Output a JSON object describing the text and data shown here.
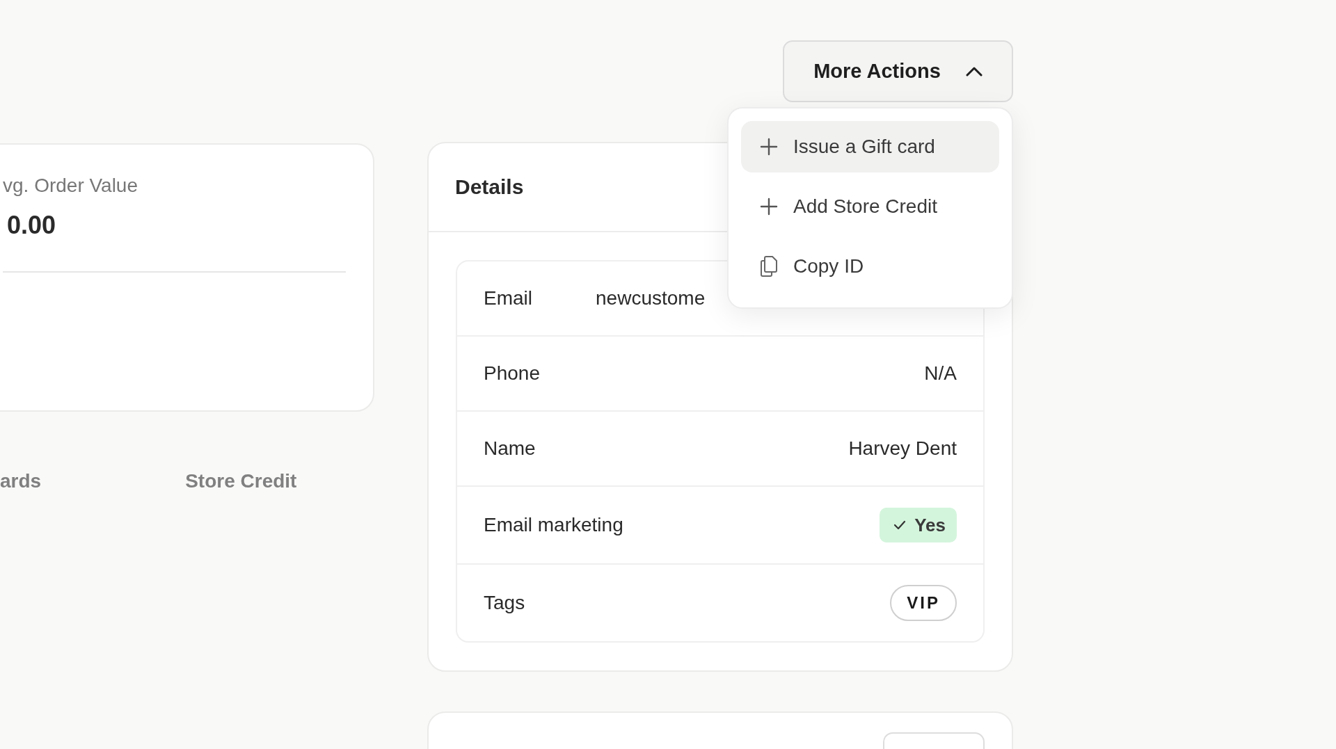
{
  "stats_card": {
    "label": "vg. Order Value",
    "value": "0.00"
  },
  "tabs": [
    {
      "label": "ards",
      "selected": false
    },
    {
      "label": "Store Credit",
      "selected": false
    }
  ],
  "more_actions": {
    "label": "More Actions",
    "expanded": true,
    "items": [
      {
        "kind": "add",
        "label": "Issue a Gift card",
        "highlighted": true
      },
      {
        "kind": "add",
        "label": "Add Store Credit",
        "highlighted": false
      },
      {
        "kind": "copy",
        "label": "Copy ID",
        "highlighted": false
      }
    ]
  },
  "details": {
    "title": "Details",
    "rows": [
      {
        "kind": "email",
        "label": "Email",
        "value": "newcustome"
      },
      {
        "kind": "text",
        "label": "Phone",
        "value": "N/A"
      },
      {
        "kind": "text",
        "label": "Name",
        "value": "Harvey Dent"
      },
      {
        "kind": "status",
        "label": "Email marketing",
        "value": "Yes",
        "checked": true
      },
      {
        "kind": "tag",
        "label": "Tags",
        "value": "VIP"
      }
    ]
  }
}
